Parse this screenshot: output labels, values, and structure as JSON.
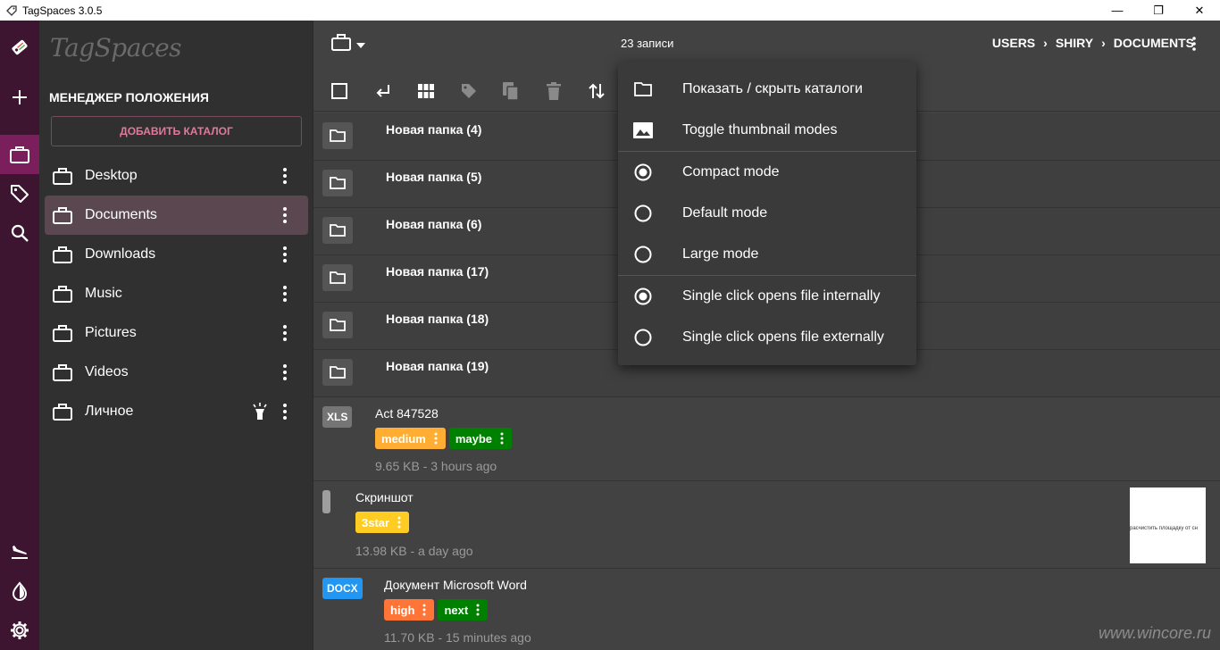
{
  "window": {
    "title": "TagSpaces 3.0.5",
    "minimize": "—",
    "restore": "❐",
    "close": "✕"
  },
  "sidebar": {
    "logo": "TagSpaces",
    "heading": "Менеджер положения",
    "add_location": "ДОБАВИТЬ КАТАЛОГ",
    "locations": [
      {
        "label": "Desktop"
      },
      {
        "label": "Documents"
      },
      {
        "label": "Downloads"
      },
      {
        "label": "Music"
      },
      {
        "label": "Pictures"
      },
      {
        "label": "Videos"
      },
      {
        "label": "Личное"
      }
    ]
  },
  "header": {
    "entry_count": "23 записи",
    "breadcrumb": [
      "USERS",
      "SHIRY",
      "DOCUMENTS"
    ],
    "breadcrumb_sep": "›"
  },
  "folders": [
    {
      "name": "Новая папка (4)"
    },
    {
      "name": "Новая папка (5)"
    },
    {
      "name": "Новая папка (6)"
    },
    {
      "name": "Новая папка (17)"
    },
    {
      "name": "Новая папка (18)"
    },
    {
      "name": "Новая папка (19)"
    }
  ],
  "files": [
    {
      "ext": "XLS",
      "ext_color": "#757575",
      "name": "Act 847528",
      "meta": "9.65 KB - 3 hours ago",
      "tags": [
        {
          "label": "medium",
          "color": "#ffad33"
        },
        {
          "label": "maybe",
          "color": "#008000"
        }
      ]
    },
    {
      "ext": "",
      "ext_color": "#9e9e9e",
      "name": "Скриншот",
      "meta": "13.98 KB - a day ago",
      "tags": [
        {
          "label": "3star",
          "color": "#ffcc24"
        }
      ],
      "thumb_text": "расчистить площадку от сн"
    },
    {
      "ext": "DOCX",
      "ext_color": "#2196f3",
      "name": "Документ Microsoft Word",
      "meta": "11.70 KB - 15 minutes ago",
      "tags": [
        {
          "label": "high",
          "color": "#ff7537"
        },
        {
          "label": "next",
          "color": "#008000"
        }
      ]
    }
  ],
  "menu": {
    "items": [
      {
        "label": "Показать / скрыть каталоги",
        "icon": "folder-icon"
      },
      {
        "label": "Toggle thumbnail modes",
        "icon": "image-icon"
      },
      {
        "label": "Compact mode",
        "icon": "radio-checked-icon"
      },
      {
        "label": "Default mode",
        "icon": "radio-unchecked-icon"
      },
      {
        "label": "Large mode",
        "icon": "radio-unchecked-icon"
      },
      {
        "label": "Single click opens file internally",
        "icon": "radio-checked-icon"
      },
      {
        "label": "Single click opens file externally",
        "icon": "radio-unchecked-icon"
      }
    ]
  },
  "watermark": "www.wincore.ru"
}
